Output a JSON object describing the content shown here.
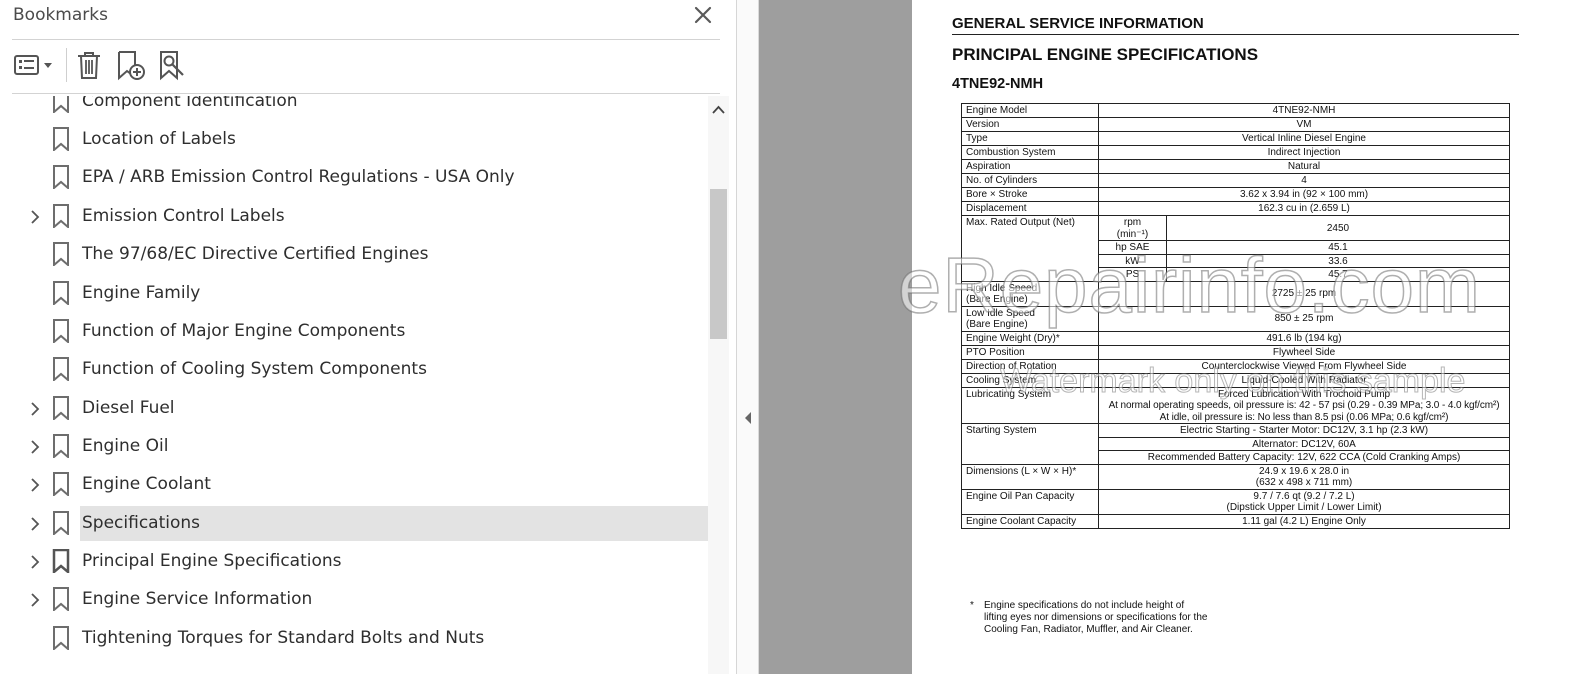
{
  "panel": {
    "title": "Bookmarks",
    "items": [
      {
        "label": "Component Identification",
        "expandable": false,
        "selected": false
      },
      {
        "label": "Location of Labels",
        "expandable": false,
        "selected": false
      },
      {
        "label": "EPA / ARB Emission Control Regulations - USA Only",
        "expandable": false,
        "selected": false
      },
      {
        "label": "Emission Control Labels",
        "expandable": true,
        "selected": false
      },
      {
        "label": "The 97/68/EC Directive Certified Engines",
        "expandable": false,
        "selected": false
      },
      {
        "label": "Engine Family",
        "expandable": false,
        "selected": false
      },
      {
        "label": "Function of Major Engine Components",
        "expandable": false,
        "selected": false
      },
      {
        "label": "Function of Cooling System Components",
        "expandable": false,
        "selected": false
      },
      {
        "label": "Diesel Fuel",
        "expandable": true,
        "selected": false
      },
      {
        "label": "Engine Oil",
        "expandable": true,
        "selected": false
      },
      {
        "label": "Engine Coolant",
        "expandable": true,
        "selected": false
      },
      {
        "label": "Specifications",
        "expandable": true,
        "selected": true
      },
      {
        "label": "Principal Engine Specifications",
        "expandable": true,
        "selected": false
      },
      {
        "label": "Engine Service Information",
        "expandable": true,
        "selected": false
      },
      {
        "label": "Tightening Torques for Standard Bolts and Nuts",
        "expandable": false,
        "selected": false
      }
    ]
  },
  "icons": {
    "close": "close-icon",
    "options": "list-options-icon",
    "delete": "trash-icon",
    "add_bookmark": "add-bookmark-icon",
    "find_bookmark": "find-bookmark-icon",
    "bookmark": "bookmark-icon",
    "expand": "chevron-right-icon",
    "scroll_up": "chevron-up-icon",
    "collapse_pane": "triangle-left-icon"
  },
  "document": {
    "header": "GENERAL SERVICE INFORMATION",
    "title": "PRINCIPAL ENGINE SPECIFICATIONS",
    "model": "4TNE92-NMH",
    "specs": {
      "engine_model": {
        "label": "Engine Model",
        "value": "4TNE92-NMH"
      },
      "version": {
        "label": "Version",
        "value": "VM"
      },
      "type": {
        "label": "Type",
        "value": "Vertical Inline Diesel Engine"
      },
      "combustion": {
        "label": "Combustion System",
        "value": "Indirect Injection"
      },
      "aspiration": {
        "label": "Aspiration",
        "value": "Natural"
      },
      "cylinders": {
        "label": "No. of Cylinders",
        "value": "4"
      },
      "bore_stroke": {
        "label": "Bore × Stroke",
        "value": "3.62 x 3.94 in (92 × 100 mm)"
      },
      "displacement": {
        "label": "Displacement",
        "value": "162.3 cu in (2.659 L)"
      },
      "rated_output": {
        "label": "Max. Rated Output (Net)",
        "rpm_unit_1": "rpm",
        "rpm_unit_2": "(min⁻¹)",
        "rpm": "2450",
        "hp_unit": "hp SAE",
        "hp": "45.1",
        "kw_unit": "kW",
        "kw": "33.6",
        "ps_unit": "PS",
        "ps": "45.7"
      },
      "high_idle": {
        "label_1": "High Idle Speed",
        "label_2": "(Bare Engine)",
        "value": "2725 ± 25 rpm"
      },
      "low_idle": {
        "label_1": "Low Idle Speed",
        "label_2": "(Bare Engine)",
        "value": "850 ± 25 rpm"
      },
      "weight": {
        "label": "Engine Weight (Dry)*",
        "value": "491.6 lb (194 kg)"
      },
      "pto": {
        "label": "PTO Position",
        "value": "Flywheel Side"
      },
      "rotation": {
        "label": "Direction of Rotation",
        "value": "Counterclockwise Viewed From Flywheel Side"
      },
      "cooling": {
        "label": "Cooling System",
        "value": "Liquid-Cooled With Radiator"
      },
      "lubrication": {
        "label": "Lubricating System",
        "line1": "Forced Lubrication With Trochoid Pump",
        "line2": "At normal operating speeds, oil pressure is: 42 - 57 psi (0.29 - 0.39 MPa; 3.0 - 4.0 kgf/cm²)",
        "line3": "At idle, oil pressure is: No less than 8.5 psi (0.06 MPa; 0.6 kgf/cm²)"
      },
      "starting": {
        "label": "Starting System",
        "line1": "Electric Starting - Starter Motor: DC12V, 3.1 hp (2.3 kW)",
        "line2": "Alternator: DC12V, 60A",
        "line3": "Recommended Battery Capacity: 12V, 622 CCA (Cold Cranking Amps)"
      },
      "dimensions": {
        "label": "Dimensions (L × W × H)*",
        "line1": "24.9 x 19.6 x 28.0 in",
        "line2": "(632 x 498 x 711 mm)"
      },
      "oil_pan": {
        "label": "Engine Oil Pan Capacity",
        "line1": "9.7 / 7.6 qt (9.2 / 7.2 L)",
        "line2": "(Dipstick Upper Limit / Lower Limit)"
      },
      "coolant": {
        "label": "Engine Coolant Capacity",
        "value": "1.11 gal (4.2 L) Engine Only"
      }
    },
    "footnote": {
      "star": "*",
      "line1": "Engine specifications do not include height of",
      "line2": "lifting eyes nor dimensions or specifications for the",
      "line3": "Cooling Fan, Radiator, Muffler, and Air Cleaner."
    },
    "watermark": {
      "line1": "eRepairinfo.com",
      "line2": "Watermark only on this sample"
    }
  }
}
